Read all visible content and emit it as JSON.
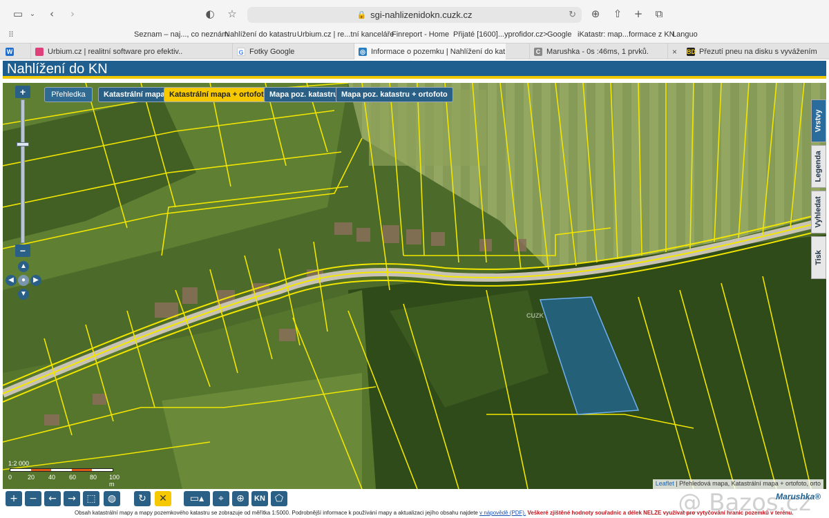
{
  "browser": {
    "url": "sgi-nahlizenidokn.cuzk.cz",
    "bookmarks": [
      "Seznam – naj..., co neznám",
      "Nahlížení do katastru",
      "Urbium.cz | re...tní kanceláře",
      "Finreport - Home",
      "Přijaté [1600]...yprofidor.cz>",
      "Google",
      "iKatastr: map...formace z KN",
      "Languo"
    ],
    "tabs": [
      {
        "label": "Urbium.cz | realitní software pro efektiv..."
      },
      {
        "label": "Fotky Google"
      },
      {
        "label": "Informace o pozemku | Nahlížení do kat..."
      },
      {
        "label": "Marushka - 0s :46ms, 1 prvků."
      },
      {
        "label": "Přezutí pneu na disku s vyvážením"
      }
    ]
  },
  "header": {
    "title": "Nahlížení do KN"
  },
  "map_buttons": [
    "Přehledka",
    "Katastrální mapa",
    "Katastrální mapa + ortofoto",
    "Mapa poz. katastru",
    "Mapa poz. katastru + ortofoto"
  ],
  "side_tabs": [
    "Vrstvy",
    "Legenda",
    "Vyhledat",
    "Tisk"
  ],
  "scale": {
    "label": "1:2 000",
    "ticks": [
      "0",
      "20",
      "40",
      "60",
      "80",
      "100 m"
    ]
  },
  "watermark": "CUZK",
  "attribution": {
    "leaflet": "Leaflet",
    "text": "| Přehledová mapa, Katastrální mapa + ortofoto, orto"
  },
  "footer": {
    "disclaimer": "Obsah katastrální mapy a mapy pozemkového katastru se zobrazuje od měřítka 1:5000. Podrobnější informace k používání mapy a aktualizaci jejího obsahu najdete",
    "link": "v nápovědě (PDF).",
    "warning": "Veškeré zjištěné hodnoty souřadnic a délek NELZE využívat pro vytyčování hranic pozemků v terénu.",
    "logo": "Marushka®",
    "bazos": "@ Bazos.cz"
  },
  "colors": {
    "accent": "#1f5f8f",
    "highlight": "#f5c800",
    "parcel_lines": "#f2e600",
    "selected_parcel": "#1e73c8"
  }
}
